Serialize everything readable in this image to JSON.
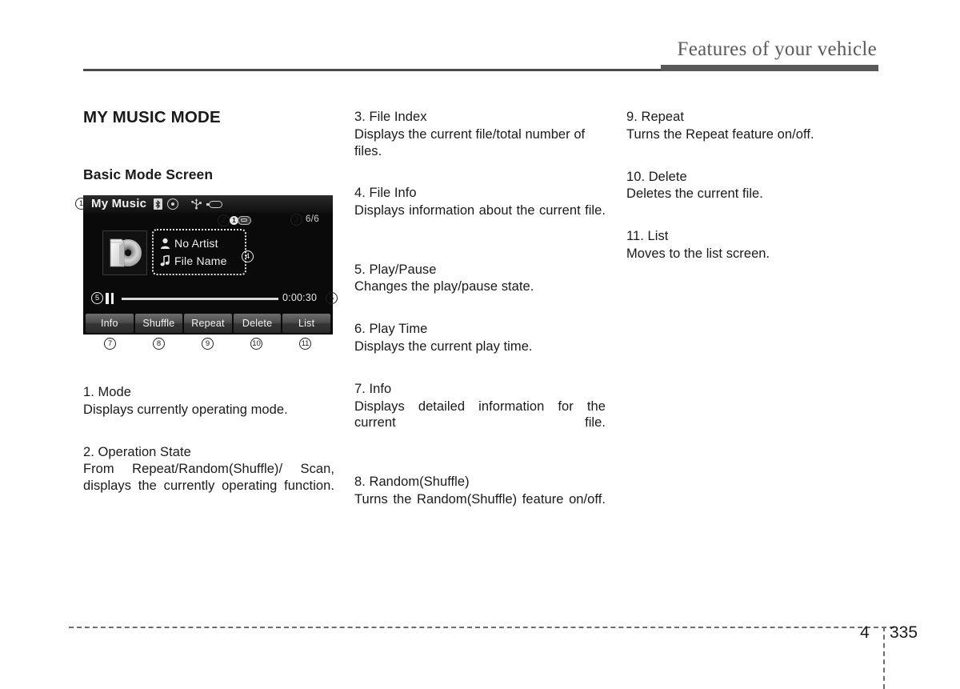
{
  "header": {
    "title": "Features of your vehicle"
  },
  "left_column": {
    "section_title": "MY MUSIC MODE",
    "sub_title": "Basic Mode Screen",
    "items": [
      {
        "title": "1. Mode",
        "desc": "Displays currently operating mode."
      },
      {
        "title": "2. Operation State",
        "desc": "From Repeat/Random(Shuffle)/ Scan, displays the currently operating function."
      }
    ]
  },
  "middle_column": {
    "items": [
      {
        "title": "3. File Index",
        "desc": "Displays the current file/total number of files."
      },
      {
        "title": "4. File Info",
        "desc": "Displays information about the current file."
      },
      {
        "title": "5. Play/Pause",
        "desc": "Changes the play/pause state."
      },
      {
        "title": "6. Play Time",
        "desc": "Displays the current play time."
      },
      {
        "title": "7. Info",
        "desc": "Displays detailed information for the current file."
      },
      {
        "title": "8. Random(Shuffle)",
        "desc": "Turns the Random(Shuffle) feature on/off."
      }
    ]
  },
  "right_column": {
    "items": [
      {
        "title": "9. Repeat",
        "desc": "Turns the Repeat feature on/off."
      },
      {
        "title": "10. Delete",
        "desc": "Deletes the current file."
      },
      {
        "title": "11. List",
        "desc": "Moves to the list screen."
      }
    ]
  },
  "device_screen": {
    "mode_label": "My Music",
    "status_icons": [
      "bluetooth-icon",
      "disc-icon",
      "usb-icon",
      "aux-device-icon"
    ],
    "operation_state": {
      "repeat_number": "1",
      "icon": "repeat-one-icon"
    },
    "file_index": "6/6",
    "album_art_icon": "folder-disc-icon",
    "file_info": {
      "artist_icon": "person-icon",
      "artist": "No Artist",
      "file_icon": "music-note-icon",
      "file_name": "File Name"
    },
    "playback": {
      "state_icon": "pause-icon",
      "play_time": "0:00:30"
    },
    "softkeys": [
      {
        "label": "Info"
      },
      {
        "label": "Shuffle"
      },
      {
        "label": "Repeat"
      },
      {
        "label": "Delete"
      },
      {
        "label": "List"
      }
    ],
    "callouts": {
      "c1": "1",
      "c2": "2",
      "c3": "3",
      "c4": "4",
      "c5": "5",
      "c6": "6",
      "c7": "7",
      "c8": "8",
      "c9": "9",
      "c10": "10",
      "c11": "11"
    }
  },
  "footer": {
    "chapter": "4",
    "page": "335"
  }
}
